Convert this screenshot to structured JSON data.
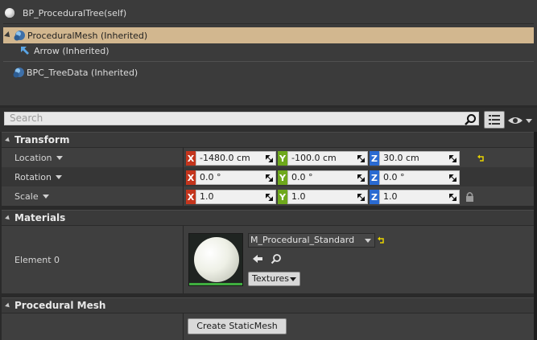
{
  "components": {
    "self_label": "BP_ProceduralTree(self)",
    "items": [
      {
        "label": "ProceduralMesh (Inherited)",
        "icon": "mesh-component-icon",
        "selected": true
      },
      {
        "label": "Arrow (Inherited)",
        "icon": "arrow-component-icon",
        "selected": false
      },
      {
        "label": "BPC_TreeData (Inherited)",
        "icon": "mesh-component-icon",
        "selected": false
      }
    ]
  },
  "search": {
    "placeholder": "Search"
  },
  "transform": {
    "header": "Transform",
    "location": {
      "label": "Location",
      "x": "-1480.0 cm",
      "y": "-100.0 cm",
      "z": "30.0 cm"
    },
    "rotation": {
      "label": "Rotation",
      "x": "0.0 °",
      "y": "0.0 °",
      "z": "0.0 °"
    },
    "scale": {
      "label": "Scale",
      "x": "1.0",
      "y": "1.0",
      "z": "1.0"
    },
    "axis": {
      "x": "X",
      "y": "Y",
      "z": "Z"
    }
  },
  "materials": {
    "header": "Materials",
    "element_label": "Element 0",
    "material_name": "M_Procedural_Standard",
    "textures_label": "Textures"
  },
  "procedural_mesh": {
    "header": "Procedural Mesh",
    "create_button": "Create StaticMesh"
  },
  "colors": {
    "selection": "#d2b78f",
    "axis_x": "#c4351d",
    "axis_y": "#6ea81c",
    "axis_z": "#2a6ad1",
    "accent": "#1a67b3"
  }
}
